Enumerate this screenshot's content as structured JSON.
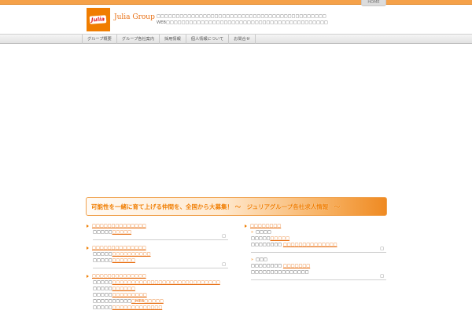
{
  "header": {
    "home_label": "HOME",
    "logo_text": "Julia",
    "brand_name": "Julia Group",
    "intro_line1": "□□□□□□□□□□□□□□□□□□□□□□□□□□□□□□□□□□□□□□□□□□□□",
    "intro_line2": "WEB□□□□□□□□□□□□□□□□□□□□□□□□□□□□□□□□□□□□□□□□□□"
  },
  "nav": {
    "items": [
      "グループ概要",
      "グループ各社案内",
      "採用情報",
      "個人情報について",
      "お問合せ"
    ]
  },
  "banner": {
    "text": "可能性を一緒に育て上げる仲間を、全国から大募集！ 〜　ジュリアグループ各社求人情報　〜"
  },
  "left": {
    "s1": {
      "title": "□□□□□□□□□□□□□□",
      "r1_label": "□□□□□",
      "r1_link": "□□□□□",
      "mark": "□"
    },
    "s2": {
      "title": "□□□□□□□□□□□□□□",
      "r1_label": "□□□□□",
      "r1_link": "□□□□□□□□□□",
      "r2_label": "□□□□□",
      "r2_link": "□□□□□□",
      "mark": "□"
    },
    "s3": {
      "title": "□□□□□□□□□□□□□□",
      "r1_label": "□□□□□",
      "r1_link": "□□□□□□□□□□□□□□□□□□□□□□□□□□□□",
      "r2_label": "□□□□□",
      "r2_link": "□□□□□□",
      "r3_label": "□□□□□",
      "r3_link": "□□□□□□□□□",
      "r4_label": "□□□□□□□□□□",
      "r4_link": "□MEB□□□□□",
      "r5_label": "□□□□□",
      "r5_link": "□□□□□□□□□□□□□"
    }
  },
  "right": {
    "title": "□□□□□□□□",
    "g1": {
      "head": "□□□□",
      "r1_label": "□□□□□",
      "r1_link": "□□□□□",
      "r2_label": "□□□□□□□□",
      "r2_link": "□□□□□□□□□□□□□□",
      "mark": "□"
    },
    "g2": {
      "head": "□□□",
      "r1_label": "□□□□□□□□",
      "r1_link": "□□□□□□□",
      "r2_label": "□□□□□□□□□□□□□□□",
      "mark": "□"
    }
  },
  "colors": {
    "accent": "#f07d00",
    "link": "#e86f12",
    "top_bar": "#f5a149"
  }
}
